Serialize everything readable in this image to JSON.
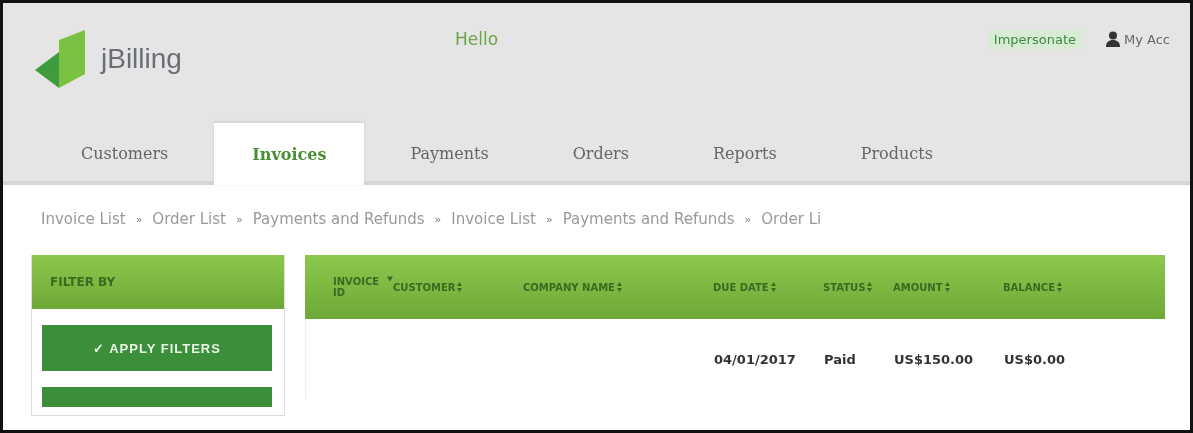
{
  "header": {
    "logo": "jBilling",
    "greeting": "Hello",
    "impersonate": "Impersonate",
    "account": "My Acc"
  },
  "tabs": [
    {
      "label": "Customers",
      "selected": false
    },
    {
      "label": "Invoices",
      "selected": true
    },
    {
      "label": "Payments",
      "selected": false
    },
    {
      "label": "Orders",
      "selected": false
    },
    {
      "label": "Reports",
      "selected": false
    },
    {
      "label": "Products",
      "selected": false
    }
  ],
  "breadcrumbs": {
    "separator": "»",
    "items": [
      "Invoice List",
      "Order List",
      "Payments and Refunds",
      "Invoice List",
      "Payments and Refunds",
      "Order Li"
    ]
  },
  "filter": {
    "title": "FILTER BY",
    "apply_button": "✓ APPLY FILTERS"
  },
  "table": {
    "columns": [
      {
        "label": "INVOICE ID",
        "sorted": true
      },
      {
        "label": "CUSTOMER",
        "sorted": false
      },
      {
        "label": "COMPANY NAME",
        "sorted": false
      },
      {
        "label": "DUE DATE",
        "sorted": false
      },
      {
        "label": "STATUS",
        "sorted": false
      },
      {
        "label": "AMOUNT",
        "sorted": false
      },
      {
        "label": "BALANCE",
        "sorted": false
      }
    ],
    "rows": [
      [
        "",
        "",
        "",
        "04/01/2017",
        "Paid",
        "US$150.00",
        "US$0.00"
      ]
    ]
  }
}
